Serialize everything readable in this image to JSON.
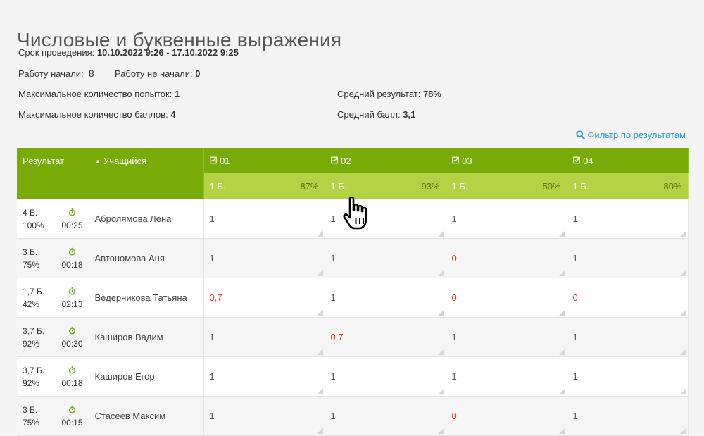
{
  "title": "Числовые и буквенные выражения",
  "period_label": "Срок проведения:",
  "period_value": "10.10.2022 9:26 - 17.10.2022 9:25",
  "started_label": "Работу начали:",
  "started_value": "8",
  "not_started_label": "Работу не начали:",
  "not_started_value": "0",
  "max_attempts_label": "Максимальное количество попыток:",
  "max_attempts_value": "1",
  "max_points_label": "Максимальное количество баллов:",
  "max_points_value": "4",
  "avg_result_label": "Средний результат:",
  "avg_result_value": "78%",
  "avg_score_label": "Средний балл:",
  "avg_score_value": "3,1",
  "filter_label": "Фильтр по результатам",
  "table": {
    "col_result": "Результат",
    "col_student": "Учащийся",
    "questions": [
      {
        "label": "01",
        "points": "1 Б.",
        "pct": "87%"
      },
      {
        "label": "02",
        "points": "1 Б.",
        "pct": "93%"
      },
      {
        "label": "03",
        "points": "1 Б.",
        "pct": "50%"
      },
      {
        "label": "04",
        "points": "1 Б.",
        "pct": "80%"
      }
    ],
    "rows": [
      {
        "score": "4 Б.",
        "percent": "100%",
        "time": "00:25",
        "name": "Абролямова Лена",
        "answers": [
          "1",
          "1",
          "1",
          "1"
        ]
      },
      {
        "score": "3 Б.",
        "percent": "75%",
        "time": "00:18",
        "name": "Автономова Аня",
        "answers": [
          "1",
          "1",
          "0",
          "1"
        ]
      },
      {
        "score": "1,7 Б.",
        "percent": "42%",
        "time": "02:13",
        "name": "Ведерникова Татьяна",
        "answers": [
          "0,7",
          "1",
          "0",
          "0"
        ]
      },
      {
        "score": "3,7 Б.",
        "percent": "92%",
        "time": "00:30",
        "name": "Каширов Вадим",
        "answers": [
          "1",
          "0,7",
          "1",
          "1"
        ]
      },
      {
        "score": "3,7 Б.",
        "percent": "92%",
        "time": "00:18",
        "name": "Каширов Егор",
        "answers": [
          "1",
          "1",
          "1",
          "1"
        ]
      },
      {
        "score": "3 Б.",
        "percent": "75%",
        "time": "00:15",
        "name": "Стасеев Максим",
        "answers": [
          "1",
          "1",
          "0",
          "1"
        ]
      }
    ]
  },
  "colors": {
    "header_green": "#78ab07",
    "subheader_green": "#b3d244",
    "error_red": "#e23b2a",
    "link_blue": "#2a9bd8"
  }
}
